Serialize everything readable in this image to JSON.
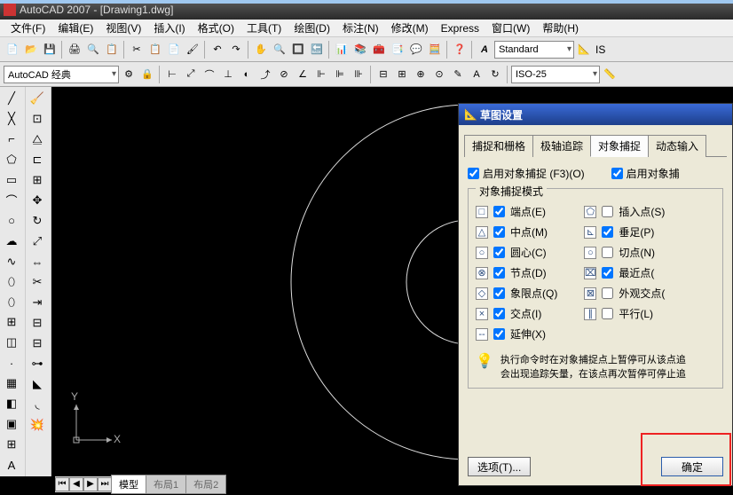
{
  "title": "AutoCAD 2007 - [Drawing1.dwg]",
  "menus": [
    "文件(F)",
    "编辑(E)",
    "视图(V)",
    "插入(I)",
    "格式(O)",
    "工具(T)",
    "绘图(D)",
    "标注(N)",
    "修改(M)",
    "Express",
    "窗口(W)",
    "帮助(H)"
  ],
  "style_combo": "Standard",
  "dim_combo": "ISO-25",
  "workspace_combo": "AutoCAD 经典",
  "iso_label": "IS",
  "tabs": {
    "model": "模型",
    "layout1": "布局1",
    "layout2": "布局2"
  },
  "ucs": {
    "x": "X",
    "y": "Y"
  },
  "dialog": {
    "title": "草图设置",
    "tabs": [
      "捕捉和栅格",
      "极轴追踪",
      "对象捕捉",
      "动态输入"
    ],
    "enable_osnap": "启用对象捕捉  (F3)(O)",
    "enable_otrack": "启用对象捕",
    "fieldset_label": "对象捕捉模式",
    "left_items": [
      {
        "sym": "□",
        "label": "端点(E)",
        "chk": true
      },
      {
        "sym": "△",
        "label": "中点(M)",
        "chk": true
      },
      {
        "sym": "○",
        "label": "圆心(C)",
        "chk": true
      },
      {
        "sym": "⊗",
        "label": "节点(D)",
        "chk": true
      },
      {
        "sym": "◇",
        "label": "象限点(Q)",
        "chk": true
      },
      {
        "sym": "×",
        "label": "交点(I)",
        "chk": true
      },
      {
        "sym": "--",
        "label": "延伸(X)",
        "chk": true
      }
    ],
    "right_items": [
      {
        "sym": "⬠",
        "label": "插入点(S)",
        "chk": false
      },
      {
        "sym": "⊾",
        "label": "垂足(P)",
        "chk": true
      },
      {
        "sym": "○",
        "label": "切点(N)",
        "chk": false
      },
      {
        "sym": "⌧",
        "label": "最近点(",
        "chk": true
      },
      {
        "sym": "⊠",
        "label": "外观交点(",
        "chk": false
      },
      {
        "sym": "∥",
        "label": "平行(L)",
        "chk": false
      }
    ],
    "hint": "执行命令时在对象捕捉点上暂停可从该点追\n会出现追踪矢量，在该点再次暂停可停止追",
    "options_btn": "选项(T)...",
    "ok_btn": "确定"
  }
}
